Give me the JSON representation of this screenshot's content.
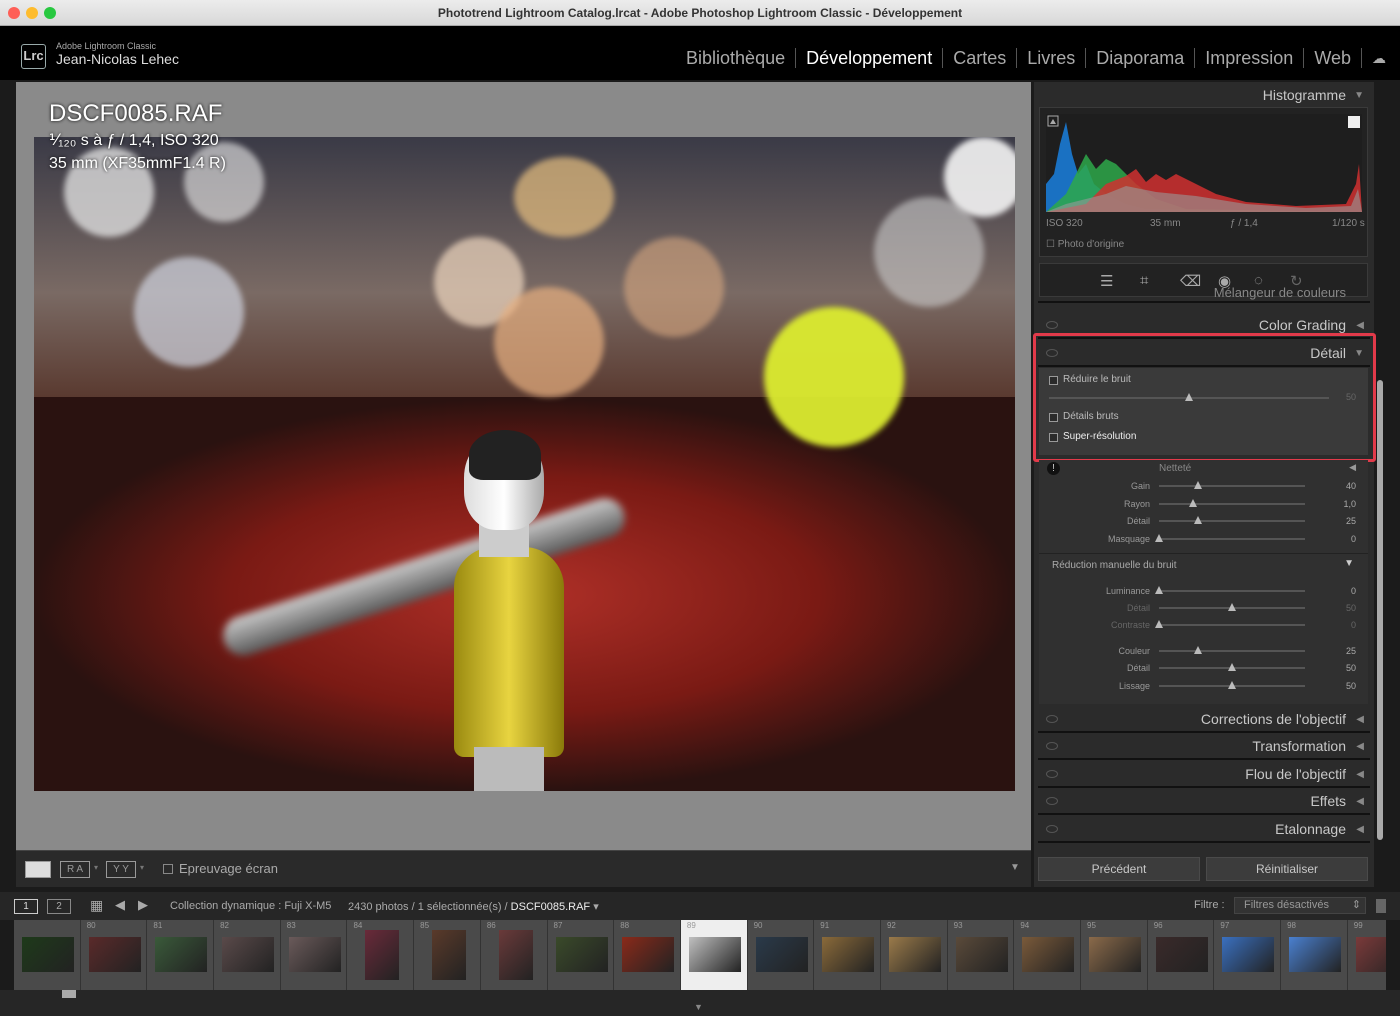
{
  "window": {
    "title": "Phototrend Lightroom Catalog.lrcat - Adobe Photoshop Lightroom Classic - Développement"
  },
  "identity": {
    "logo": "Lrc",
    "app_name": "Adobe Lightroom Classic",
    "user": "Jean-Nicolas Lehec"
  },
  "modules": [
    "Bibliothèque",
    "Développement",
    "Cartes",
    "Livres",
    "Diaporama",
    "Impression",
    "Web"
  ],
  "photo": {
    "filename": "DSCF0085.RAF",
    "exposure": "⅟₁₂₀ s à ƒ / 1,4, ISO 320",
    "lens": "35 mm (XF35mmF1.4 R)"
  },
  "toolbar": {
    "view1": "",
    "ra": "R A",
    "yy": "Y Y",
    "softproof": "Epreuvage écran"
  },
  "histogram": {
    "title": "Histogramme",
    "iso": "ISO 320",
    "focal": "35 mm",
    "aperture": "ƒ / 1,4",
    "shutter": "1/120 s",
    "original": "Photo d'origine"
  },
  "panels": {
    "mixer": "Mélangeur de couleurs",
    "color_grading": "Color Grading",
    "detail": "Détail",
    "lens_corr": "Corrections de l'objectif",
    "transform": "Transformation",
    "lens_blur": "Flou de l'objectif",
    "effects": "Effets",
    "calibration": "Etalonnage"
  },
  "detail": {
    "reduce_noise": "Réduire le bruit",
    "reduce_value": "50",
    "raw_details": "Détails bruts",
    "super_res": "Super-résolution"
  },
  "sharpening": {
    "title": "Netteté",
    "rows": [
      {
        "label": "Gain",
        "value": "40",
        "pos": 0.27
      },
      {
        "label": "Rayon",
        "value": "1,0",
        "pos": 0.23
      },
      {
        "label": "Détail",
        "value": "25",
        "pos": 0.27
      },
      {
        "label": "Masquage",
        "value": "0",
        "pos": 0.0
      }
    ]
  },
  "noise": {
    "title": "Réduction manuelle du bruit",
    "rows": [
      {
        "label": "Luminance",
        "value": "0",
        "pos": 0.0
      },
      {
        "label": "Détail",
        "value": "50",
        "pos": 0.5
      },
      {
        "label": "Contraste",
        "value": "0",
        "pos": 0.0
      },
      {
        "label": "Couleur",
        "value": "25",
        "pos": 0.27
      },
      {
        "label": "Détail",
        "value": "50",
        "pos": 0.5
      },
      {
        "label": "Lissage",
        "value": "50",
        "pos": 0.5
      }
    ]
  },
  "buttons": {
    "previous": "Précédent",
    "reset": "Réinitialiser"
  },
  "filmstrip_bar": {
    "page1": "1",
    "page2": "2",
    "collection": "Collection dynamique : Fuji X-M5",
    "count": "2430 photos / 1 sélectionnée(s) / ",
    "current": "DSCF0085.RAF",
    "filter_label": "Filtre :",
    "filter_value": "Filtres désactivés"
  },
  "thumbnails": [
    "",
    "80",
    "81",
    "82",
    "83",
    "84",
    "85",
    "86",
    "87",
    "88",
    "89",
    "90",
    "91",
    "92",
    "93",
    "94",
    "95",
    "96",
    "97",
    "98",
    "99"
  ],
  "colors": {
    "accent_red": "#e23a4a",
    "panel_bg": "#2b2b2b"
  }
}
